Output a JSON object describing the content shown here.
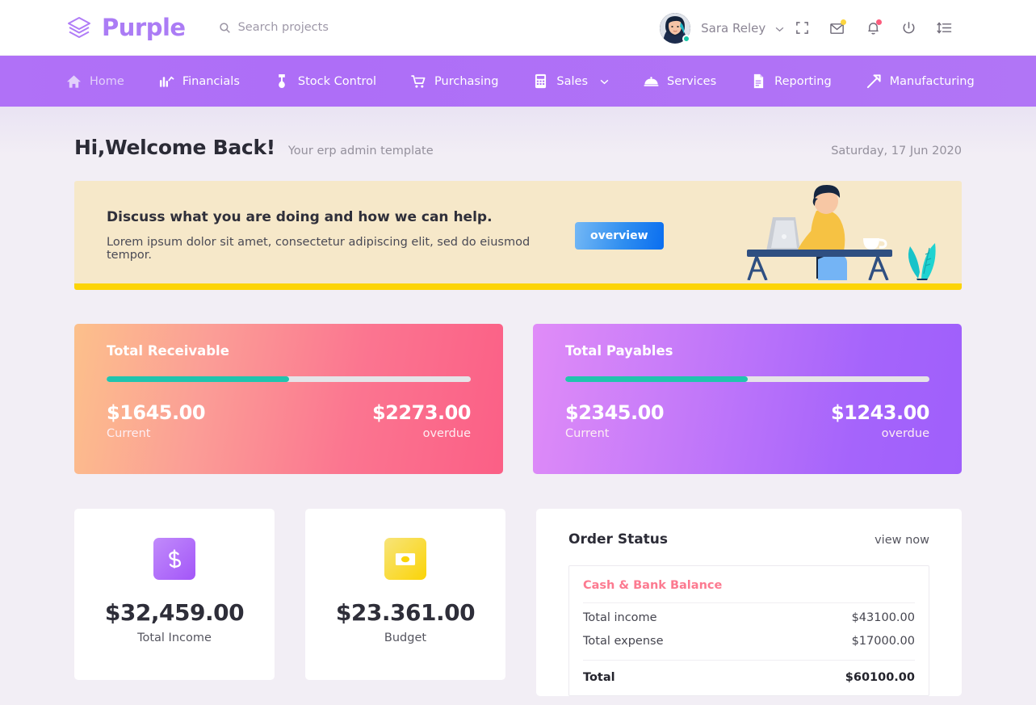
{
  "brand": {
    "name": "Purple",
    "logo_icon": "layers-icon"
  },
  "search": {
    "placeholder": "Search projects",
    "value": "",
    "icon": "search-icon"
  },
  "topbar": {
    "user_name": "Sara Reley",
    "caret": "⌄",
    "icons": [
      {
        "name": "fullscreen-icon",
        "badge": ""
      },
      {
        "name": "mail-icon",
        "badge": "yellow"
      },
      {
        "name": "bell-icon",
        "badge": "red"
      },
      {
        "name": "power-icon",
        "badge": ""
      },
      {
        "name": "list-settings-icon",
        "badge": ""
      }
    ]
  },
  "nav": {
    "items": [
      {
        "label": "Home",
        "icon": "home-icon",
        "active": true,
        "caret": ""
      },
      {
        "label": "Financials",
        "icon": "chart-bars-icon",
        "active": false,
        "caret": ""
      },
      {
        "label": "Stock Control",
        "icon": "stock-icon",
        "active": false,
        "caret": ""
      },
      {
        "label": "Purchasing",
        "icon": "cart-icon",
        "active": false,
        "caret": ""
      },
      {
        "label": "Sales",
        "icon": "calculator-icon",
        "active": false,
        "caret": "⌄"
      },
      {
        "label": "Services",
        "icon": "cloche-icon",
        "active": false,
        "caret": ""
      },
      {
        "label": "Reporting",
        "icon": "document-icon",
        "active": false,
        "caret": ""
      },
      {
        "label": "Manufacturing",
        "icon": "hammer-icon",
        "active": false,
        "caret": ""
      }
    ]
  },
  "welcome": {
    "title": "Hi,Welcome Back!",
    "subtitle": "Your erp admin template",
    "date": "Saturday, 17 Jun 2020"
  },
  "banner": {
    "heading": "Discuss what you are doing and how we can help.",
    "paragraph": "Lorem ipsum dolor sit amet, consectetur adipiscing elit, sed do eiusmod tempor.",
    "button_label": "overview",
    "illustration": "person-at-desk-illustration",
    "bg_color": "#f6e8c9",
    "strip_color": "#fcd406"
  },
  "totals": [
    {
      "title": "Total Receivable",
      "progress_percent": 50,
      "progress_color": "#20c4ae",
      "current_amount": "$1645.00",
      "current_label": "Current",
      "overdue_amount": "$2273.00",
      "overdue_label": "overdue"
    },
    {
      "title": "Total Payables",
      "progress_percent": 50,
      "progress_color": "#20c4ae",
      "current_amount": "$2345.00",
      "current_label": "Current",
      "overdue_amount": "$1243.00",
      "overdue_label": "overdue"
    }
  ],
  "stats": [
    {
      "value": "$32,459.00",
      "label": "Total Income",
      "icon": "dollar-sign-icon",
      "tile_color": "#a356f8"
    },
    {
      "value": "$23.361.00",
      "label": "Budget",
      "icon": "money-bill-icon",
      "tile_color": "#fbd407"
    }
  ],
  "order_status": {
    "title": "Order Status",
    "link_label": "view now",
    "balance_title": "Cash & Bank Balance",
    "balance_title_color": "#fc7a90",
    "rows": [
      {
        "label": "Total income",
        "value": "$43100.00"
      },
      {
        "label": "Total expense",
        "value": "$17000.00"
      }
    ],
    "total": {
      "label": "Total",
      "value": "$60100.00"
    }
  }
}
